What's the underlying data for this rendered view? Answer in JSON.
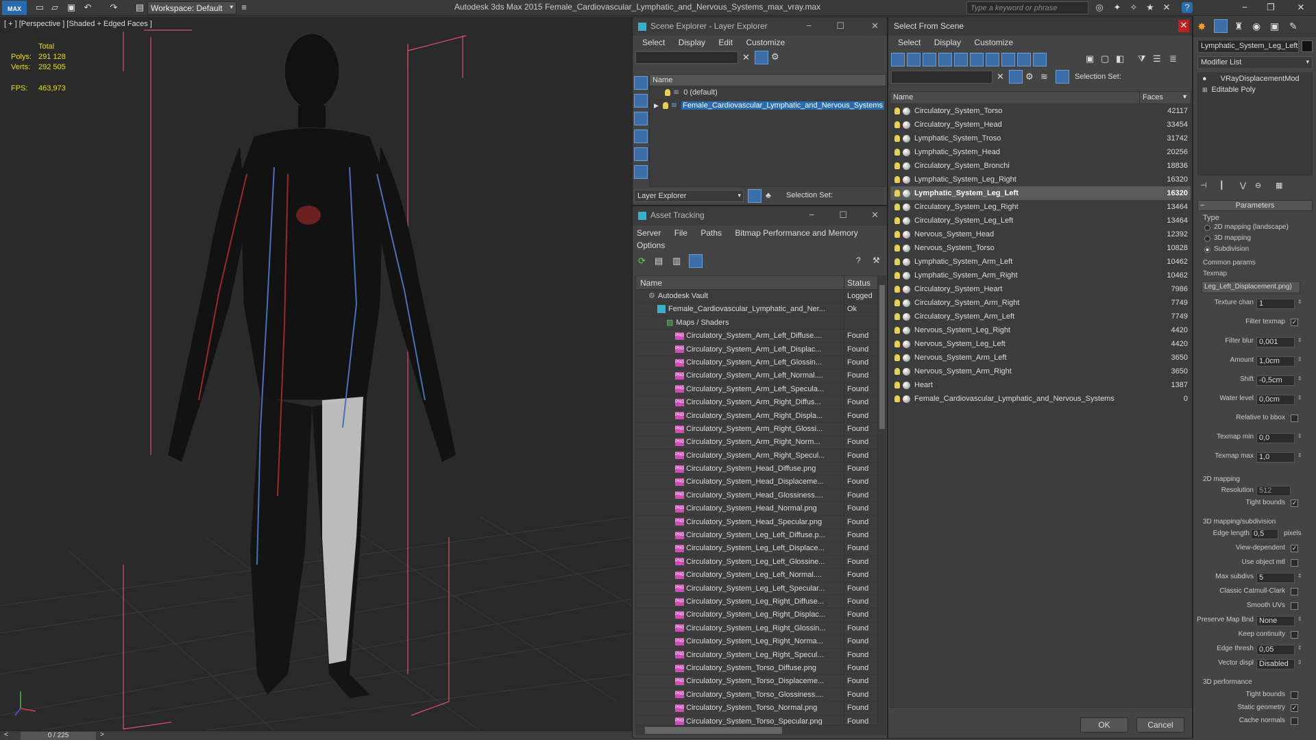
{
  "app": {
    "title": "Autodesk 3ds Max  2015    Female_Cardiovascular_Lymphatic_and_Nervous_Systems_max_vray.max",
    "workspace": "Workspace: Default",
    "search_placeholder": "Type a keyword or phrase",
    "logo": "MAX"
  },
  "viewport": {
    "label": "[ + ] [Perspective ] [Shaded + Edged Faces ]",
    "stats": {
      "total_label": "Total",
      "polys_label": "Polys:",
      "polys": "291 128",
      "verts_label": "Verts:",
      "verts": "292 505",
      "fps_label": "FPS:",
      "fps": "463,973"
    },
    "timeline": "0 / 225"
  },
  "scene_explorer": {
    "title": "Scene Explorer - Layer Explorer",
    "menu": [
      "Select",
      "Display",
      "Edit",
      "Customize"
    ],
    "column": "Name",
    "layers": [
      "0 (default)",
      "Female_Cardiovascular_Lymphatic_and_Nervous_Systems"
    ],
    "footer_left": "Layer Explorer",
    "footer_right": "Selection Set:"
  },
  "asset_tracking": {
    "title": "Asset Tracking",
    "menu": [
      "Server",
      "File",
      "Paths",
      "Bitmap Performance and Memory"
    ],
    "menu2": "Options",
    "col_name": "Name",
    "col_status": "Status",
    "rows": [
      {
        "name": "Autodesk Vault",
        "status": "Logged",
        "indent": 0,
        "kind": "vault"
      },
      {
        "name": "Female_Cardiovascular_Lymphatic_and_Ner...",
        "status": "Ok",
        "indent": 1,
        "kind": "max"
      },
      {
        "name": "Maps / Shaders",
        "status": "",
        "indent": 2,
        "kind": "maps"
      },
      {
        "name": "Circulatory_System_Arm_Left_Diffuse....",
        "status": "Found",
        "indent": 3,
        "kind": "png"
      },
      {
        "name": "Circulatory_System_Arm_Left_Displac...",
        "status": "Found",
        "indent": 3,
        "kind": "png"
      },
      {
        "name": "Circulatory_System_Arm_Left_Glossin...",
        "status": "Found",
        "indent": 3,
        "kind": "png"
      },
      {
        "name": "Circulatory_System_Arm_Left_Normal....",
        "status": "Found",
        "indent": 3,
        "kind": "png"
      },
      {
        "name": "Circulatory_System_Arm_Left_Specula...",
        "status": "Found",
        "indent": 3,
        "kind": "png"
      },
      {
        "name": "Circulatory_System_Arm_Right_Diffus...",
        "status": "Found",
        "indent": 3,
        "kind": "png"
      },
      {
        "name": "Circulatory_System_Arm_Right_Displa...",
        "status": "Found",
        "indent": 3,
        "kind": "png"
      },
      {
        "name": "Circulatory_System_Arm_Right_Glossi...",
        "status": "Found",
        "indent": 3,
        "kind": "png"
      },
      {
        "name": "Circulatory_System_Arm_Right_Norm...",
        "status": "Found",
        "indent": 3,
        "kind": "png"
      },
      {
        "name": "Circulatory_System_Arm_Right_Specul...",
        "status": "Found",
        "indent": 3,
        "kind": "png"
      },
      {
        "name": "Circulatory_System_Head_Diffuse.png",
        "status": "Found",
        "indent": 3,
        "kind": "png"
      },
      {
        "name": "Circulatory_System_Head_Displaceme...",
        "status": "Found",
        "indent": 3,
        "kind": "png"
      },
      {
        "name": "Circulatory_System_Head_Glossiness....",
        "status": "Found",
        "indent": 3,
        "kind": "png"
      },
      {
        "name": "Circulatory_System_Head_Normal.png",
        "status": "Found",
        "indent": 3,
        "kind": "png"
      },
      {
        "name": "Circulatory_System_Head_Specular.png",
        "status": "Found",
        "indent": 3,
        "kind": "png"
      },
      {
        "name": "Circulatory_System_Leg_Left_Diffuse.p...",
        "status": "Found",
        "indent": 3,
        "kind": "png"
      },
      {
        "name": "Circulatory_System_Leg_Left_Displace...",
        "status": "Found",
        "indent": 3,
        "kind": "png"
      },
      {
        "name": "Circulatory_System_Leg_Left_Glossine...",
        "status": "Found",
        "indent": 3,
        "kind": "png"
      },
      {
        "name": "Circulatory_System_Leg_Left_Normal....",
        "status": "Found",
        "indent": 3,
        "kind": "png"
      },
      {
        "name": "Circulatory_System_Leg_Left_Specular...",
        "status": "Found",
        "indent": 3,
        "kind": "png"
      },
      {
        "name": "Circulatory_System_Leg_Right_Diffuse...",
        "status": "Found",
        "indent": 3,
        "kind": "png"
      },
      {
        "name": "Circulatory_System_Leg_Right_Displac...",
        "status": "Found",
        "indent": 3,
        "kind": "png"
      },
      {
        "name": "Circulatory_System_Leg_Right_Glossin...",
        "status": "Found",
        "indent": 3,
        "kind": "png"
      },
      {
        "name": "Circulatory_System_Leg_Right_Norma...",
        "status": "Found",
        "indent": 3,
        "kind": "png"
      },
      {
        "name": "Circulatory_System_Leg_Right_Specul...",
        "status": "Found",
        "indent": 3,
        "kind": "png"
      },
      {
        "name": "Circulatory_System_Torso_Diffuse.png",
        "status": "Found",
        "indent": 3,
        "kind": "png"
      },
      {
        "name": "Circulatory_System_Torso_Displaceme...",
        "status": "Found",
        "indent": 3,
        "kind": "png"
      },
      {
        "name": "Circulatory_System_Torso_Glossiness....",
        "status": "Found",
        "indent": 3,
        "kind": "png"
      },
      {
        "name": "Circulatory_System_Torso_Normal.png",
        "status": "Found",
        "indent": 3,
        "kind": "png"
      },
      {
        "name": "Circulatory_System_Torso_Specular.png",
        "status": "Found",
        "indent": 3,
        "kind": "png"
      }
    ]
  },
  "select_from_scene": {
    "title": "Select From Scene",
    "menu": [
      "Select",
      "Display",
      "Customize"
    ],
    "selection_set": "Selection Set:",
    "col_name": "Name",
    "col_faces": "Faces",
    "selected_index": 6,
    "rows": [
      {
        "name": "Circulatory_System_Torso",
        "faces": "42117"
      },
      {
        "name": "Circulatory_System_Head",
        "faces": "33454"
      },
      {
        "name": "Lymphatic_System_Troso",
        "faces": "31742"
      },
      {
        "name": "Lymphatic_System_Head",
        "faces": "20256"
      },
      {
        "name": "Circulatory_System_Bronchi",
        "faces": "18836"
      },
      {
        "name": "Lymphatic_System_Leg_Right",
        "faces": "16320"
      },
      {
        "name": "Lymphatic_System_Leg_Left",
        "faces": "16320"
      },
      {
        "name": "Circulatory_System_Leg_Right",
        "faces": "13464"
      },
      {
        "name": "Circulatory_System_Leg_Left",
        "faces": "13464"
      },
      {
        "name": "Nervous_System_Head",
        "faces": "12392"
      },
      {
        "name": "Nervous_System_Torso",
        "faces": "10828"
      },
      {
        "name": "Lymphatic_System_Arm_Left",
        "faces": "10462"
      },
      {
        "name": "Lymphatic_System_Arm_Right",
        "faces": "10462"
      },
      {
        "name": "Circulatory_System_Heart",
        "faces": "7986"
      },
      {
        "name": "Circulatory_System_Arm_Right",
        "faces": "7749"
      },
      {
        "name": "Circulatory_System_Arm_Left",
        "faces": "7749"
      },
      {
        "name": "Nervous_System_Leg_Right",
        "faces": "4420"
      },
      {
        "name": "Nervous_System_Leg_Left",
        "faces": "4420"
      },
      {
        "name": "Nervous_System_Arm_Left",
        "faces": "3650"
      },
      {
        "name": "Nervous_System_Arm_Right",
        "faces": "3650"
      },
      {
        "name": "Heart",
        "faces": "1387"
      },
      {
        "name": "Female_Cardiovascular_Lymphatic_and_Nervous_Systems",
        "faces": "0"
      }
    ],
    "ok": "OK",
    "cancel": "Cancel"
  },
  "command_panel": {
    "object_name": "Lymphatic_System_Leg_Left",
    "modifier_list": "Modifier List",
    "stack": [
      "VRayDisplacementMod",
      "Editable Poly"
    ],
    "rollout": "Parameters",
    "type_label": "Type",
    "type_options": [
      "2D mapping (landscape)",
      "3D mapping",
      "Subdivision"
    ],
    "type_selected": 2,
    "common_params": "Common params",
    "texmap_label": "Texmap",
    "texmap": "Leg_Left_Displacement.png)",
    "fields": [
      {
        "label": "Texture chan",
        "value": "1"
      },
      {
        "label": "Filter texmap",
        "check": "✓"
      },
      {
        "label": "Filter blur",
        "value": "0,001"
      },
      {
        "label": "Amount",
        "value": "1,0cm"
      },
      {
        "label": "Shift",
        "value": "-0,5cm"
      },
      {
        "label": "Water level",
        "value": "0,0cm"
      },
      {
        "label": "Relative to bbox",
        "check": ""
      },
      {
        "label": "Texmap min",
        "value": "0,0"
      },
      {
        "label": "Texmap max",
        "value": "1,0"
      }
    ],
    "mapping2d": "2D mapping",
    "resolution_label": "Resolution",
    "resolution": "512",
    "tight_bounds_label": "Tight bounds",
    "mapping3d": "3D mapping/subdivision",
    "edge_length_label": "Edge length",
    "edge_length": "0,5",
    "pixels": "pixels",
    "sub_fields": [
      {
        "label": "View-dependent",
        "check": "✓"
      },
      {
        "label": "Use object mtl",
        "check": ""
      },
      {
        "label": "Max subdivs",
        "value": "5"
      },
      {
        "label": "Classic Catmull-Clark",
        "check": ""
      },
      {
        "label": "Smooth UVs",
        "check": ""
      },
      {
        "label": "Preserve Map Bnd",
        "value": "None"
      },
      {
        "label": "Keep continuity",
        "check": ""
      },
      {
        "label": "Edge thresh",
        "value": "0,05"
      },
      {
        "label": "Vector displ",
        "value": "Disabled"
      }
    ],
    "performance": "3D performance",
    "perf_fields": [
      {
        "label": "Tight bounds",
        "check": ""
      },
      {
        "label": "Static geometry",
        "check": "✓"
      },
      {
        "label": "Cache normals",
        "check": ""
      }
    ]
  }
}
